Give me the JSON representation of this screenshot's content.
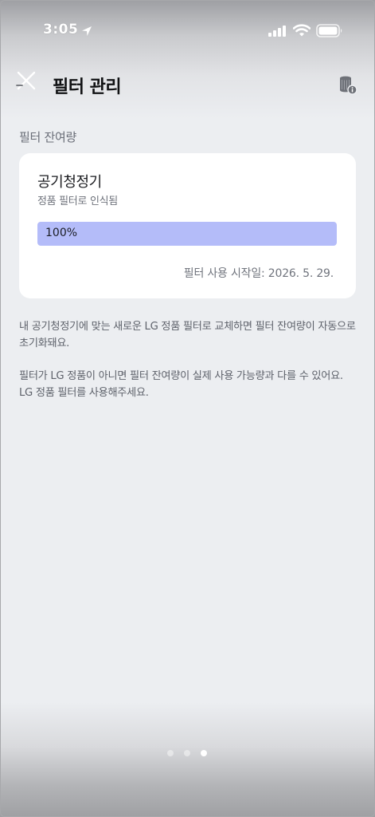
{
  "status_bar": {
    "time": "3:05",
    "icons": [
      "location-icon",
      "signal-icon",
      "wifi-icon",
      "battery-icon"
    ]
  },
  "header": {
    "title": "필터 관리",
    "close_icon": "close-icon",
    "info_icon": "filter-info-icon"
  },
  "section": {
    "label": "필터 잔여량"
  },
  "card": {
    "device_name": "공기청정기",
    "status": "정품 필터로 인식됨",
    "progress": {
      "value": 100,
      "label": "100%",
      "fill_color": "#b4bcf9",
      "track_color": "#e4e6ee"
    },
    "start_date": "필터 사용 시작일: 2026. 5. 29."
  },
  "notes": [
    "내 공기청정기에 맞는 새로운 LG 정품 필터로 교체하면 필터 잔여량이 자동으로 초기화돼요.",
    "필터가 LG 정품이 아니면 필터 잔여량이 실제 사용 가능량과 다를 수 있어요. LG 정품 필터를 사용해주세요."
  ],
  "page_indicator": {
    "count": 3,
    "active_index": 2
  },
  "colors": {
    "background": "#eceef1",
    "card": "#ffffff",
    "title_text": "#111214",
    "muted_text": "#6a6e78"
  }
}
